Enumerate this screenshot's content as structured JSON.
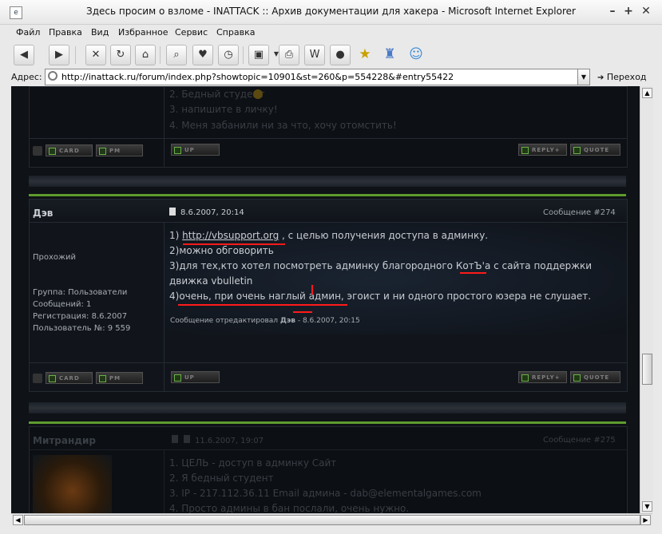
{
  "window": {
    "title": "Здесь просим о взломе - INATTACK :: Архив документации для хакера - Microsoft Internet Explorer",
    "controls": {
      "minimize": "–",
      "maximize": "+",
      "close": "✕"
    }
  },
  "menu": [
    "Файл",
    "Правка",
    "Вид",
    "Избранное",
    "Сервис",
    "Справка"
  ],
  "address": {
    "label": "Адрес:",
    "url": "http://inattack.ru/forum/index.php?showtopic=10901&st=260&p=554228&#entry55422",
    "go_label": "Переход"
  },
  "posts": {
    "prev": {
      "lines": [
        "2. Бедный студент",
        "3. напишите в личку!",
        "4. Меня забанили ни за что, хочу отомстить!"
      ],
      "buttons": {
        "card": "CARD",
        "pm": "PM",
        "up": "UP",
        "reply": "REPLY+",
        "quote": "QUOTE"
      }
    },
    "main": {
      "author": "Дэв",
      "date": "8.6.2007, 20:14",
      "post_no": "Сообщение #274",
      "rank": "Прохожий",
      "info": [
        "Группа: Пользователи",
        "Сообщений: 1",
        "Регистрация: 8.6.2007",
        "Пользователь №: 9 559"
      ],
      "line1_prefix": "1) ",
      "line1_link": "http://vbsupport.org",
      "line1_suffix": " , с целью получения доступа в админку.",
      "line2": "2)можно обговорить",
      "line3": "3)для тех,кто хотел посмотреть админку благородного КотЪ'а с сайта поддержки",
      "line4": "движка vbulletin",
      "line5": "4)очень, при очень наглый админ, эгоист и ни одного простого юзера не слушает.",
      "edit_prefix": "Сообщение отредактировал ",
      "edit_user": "Дэв",
      "edit_date": " - 8.6.2007, 20:15",
      "buttons": {
        "card": "CARD",
        "pm": "PM",
        "up": "UP",
        "reply": "REPLY+",
        "quote": "QUOTE"
      }
    },
    "next": {
      "author": "Митрандир",
      "date": "11.6.2007, 19:07",
      "post_no": "Сообщение #275",
      "lines": [
        "1. ЦЕЛЬ - доступ в админку Сайт",
        "2. Я бедный студент",
        "3. IP - 217.112.36.11 Email админа - dab@elementalgames.com",
        "4. Просто админы в бан послали, очень нужно."
      ]
    }
  },
  "colors": {
    "forum_bg": "#0f1216",
    "accent_green": "#5e9c2e",
    "annotation_red": "#ff1a1a"
  }
}
